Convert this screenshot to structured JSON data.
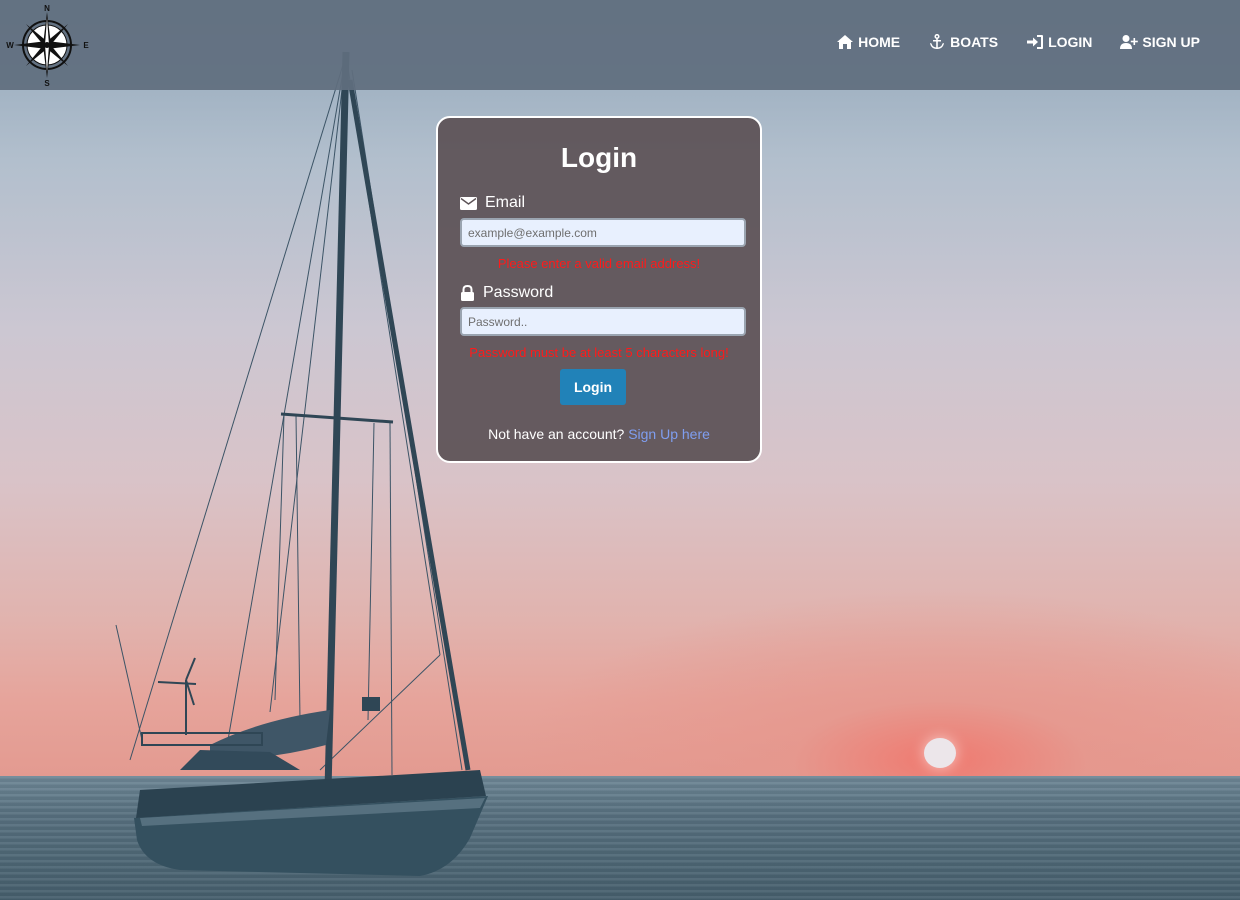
{
  "brand": {
    "logo_icon": "compass-rose-icon",
    "compass": {
      "north": "N",
      "south": "S",
      "east": "E",
      "west": "W"
    }
  },
  "nav": {
    "items": [
      {
        "label": "HOME",
        "icon": "home-icon"
      },
      {
        "label": "BOATS",
        "icon": "anchor-icon"
      },
      {
        "label": "LOGIN",
        "icon": "sign-in-icon"
      },
      {
        "label": "SIGN UP",
        "icon": "user-plus-icon"
      }
    ]
  },
  "login": {
    "title": "Login",
    "email": {
      "label": "Email",
      "icon": "envelope-icon",
      "placeholder": "example@example.com",
      "value": "",
      "error": "Please enter a valid email address!"
    },
    "password": {
      "label": "Password",
      "icon": "lock-icon",
      "placeholder": "Password..",
      "value": "",
      "error": "Password must be at least 5 characters long!"
    },
    "submit_label": "Login",
    "signup_prompt": "Not have an account?",
    "signup_link": "Sign Up here"
  },
  "colors": {
    "nav_bg": "#606e7e",
    "card_bg": "#5c5256",
    "button": "#2182b8",
    "error": "#ff1a1a",
    "link": "#7f9ef0"
  }
}
